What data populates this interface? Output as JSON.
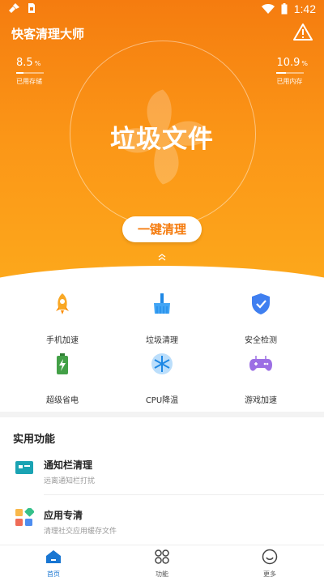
{
  "status": {
    "time": "1:42"
  },
  "app": {
    "title": "快客清理大师"
  },
  "stats": {
    "storage": {
      "value": "8.5",
      "unit": "%",
      "label": "已用存储",
      "fraction": 0.085
    },
    "memory": {
      "value": "10.9",
      "unit": "%",
      "label": "已用内存",
      "fraction": 0.109
    }
  },
  "hero": {
    "title": "垃圾文件",
    "button": "一键清理"
  },
  "grid": [
    {
      "label": "手机加速",
      "icon": "rocket-icon"
    },
    {
      "label": "垃圾清理",
      "icon": "broom-icon"
    },
    {
      "label": "安全检测",
      "icon": "shield-icon"
    },
    {
      "label": "超级省电",
      "icon": "battery-icon"
    },
    {
      "label": "CPU降温",
      "icon": "snowflake-icon"
    },
    {
      "label": "游戏加速",
      "icon": "gamepad-icon"
    }
  ],
  "section": {
    "title": "实用功能",
    "items": [
      {
        "title": "通知栏清理",
        "subtitle": "远离通知栏打扰",
        "icon": "notification-icon"
      },
      {
        "title": "应用专清",
        "subtitle": "清理社交应用缓存文件",
        "icon": "apps-icon"
      }
    ]
  },
  "tabs": [
    {
      "label": "首页",
      "icon": "home-icon"
    },
    {
      "label": "功能",
      "icon": "grid-dots-icon"
    },
    {
      "label": "更多",
      "icon": "smile-icon"
    }
  ],
  "colors": {
    "accent": "#f57c0f",
    "tab_active": "#1976d2"
  }
}
